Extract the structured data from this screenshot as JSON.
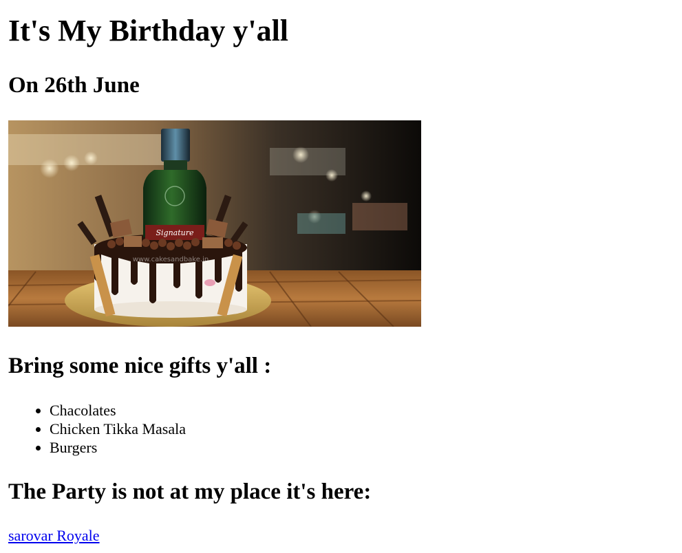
{
  "page": {
    "title": "It's My Birthday y'all",
    "date_heading": "On 26th June",
    "hero_image": {
      "alt": "Birthday cake",
      "bottle_label": "Signature",
      "watermark": "www.cakesandbake.in"
    },
    "gifts_heading": "Bring some nice gifts y'all :",
    "gifts": [
      "Chacolates",
      "Chicken Tikka Masala",
      "Burgers"
    ],
    "party_heading": "The Party is not at my place it's here:",
    "venue_link": {
      "label": "sarovar Royale"
    }
  },
  "colors": {
    "text": "#000000",
    "link": "#0000ee",
    "background": "#ffffff"
  }
}
